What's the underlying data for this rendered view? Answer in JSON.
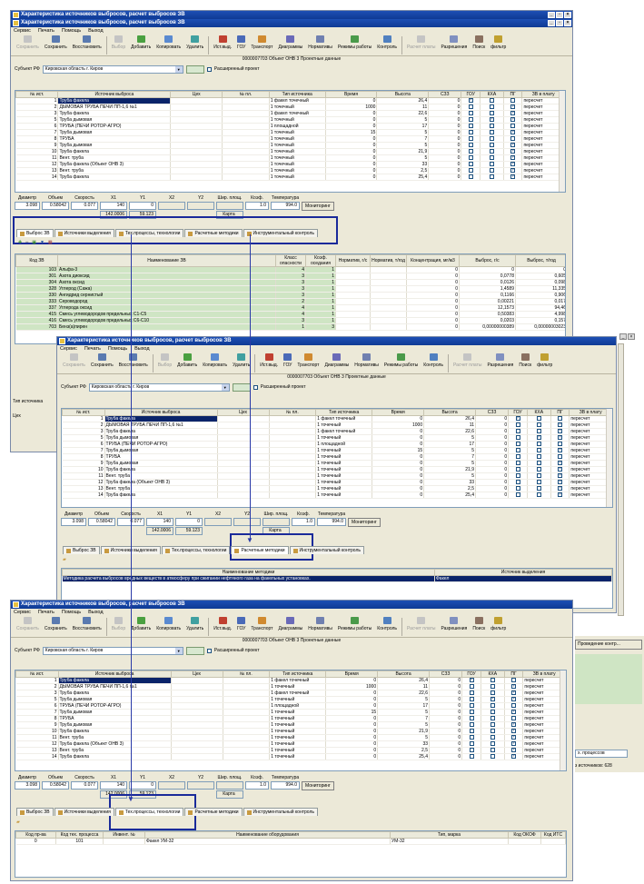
{
  "app_title": "Характеристика источников выбросов, расчет выбросов ЗВ",
  "menu": [
    "Сервис",
    "Печать",
    "Помощь",
    "Выход"
  ],
  "toolbar": [
    {
      "label": "Сохранить",
      "disabled": true,
      "icon": "save-icon"
    },
    {
      "label": "Сохранить",
      "disabled": false,
      "icon": "save-icon"
    },
    {
      "label": "Восстановить",
      "disabled": false,
      "icon": "restore-icon"
    },
    {
      "label": "Выбор",
      "disabled": true,
      "icon": "select-icon"
    },
    {
      "label": "Добавить",
      "disabled": false,
      "icon": "add-icon"
    },
    {
      "label": "Копировать",
      "disabled": false,
      "icon": "copy-icon"
    },
    {
      "label": "Удалить",
      "disabled": false,
      "icon": "delete-icon"
    },
    {
      "label": "Ист.выд.",
      "disabled": false,
      "icon": "source-icon"
    },
    {
      "label": "ГОУ",
      "disabled": false,
      "icon": "gou-icon"
    },
    {
      "label": "Транспорт",
      "disabled": false,
      "icon": "truck-icon"
    },
    {
      "label": "Диаграммы",
      "disabled": false,
      "icon": "chart-icon"
    },
    {
      "label": "Нормативы",
      "disabled": false,
      "icon": "norms-icon"
    },
    {
      "label": "Режимы работы",
      "disabled": false,
      "icon": "modes-icon"
    },
    {
      "label": "Контроль",
      "disabled": false,
      "icon": "control-icon"
    },
    {
      "label": "Расчет платы",
      "disabled": true,
      "icon": "calc-icon"
    },
    {
      "label": "Разрешения",
      "disabled": false,
      "icon": "permit-icon"
    },
    {
      "label": "Поиск",
      "disabled": false,
      "icon": "search-icon"
    },
    {
      "label": "фильтр",
      "disabled": false,
      "icon": "filter-icon"
    }
  ],
  "object_line": "0000007703 Объект ОНВ 3 Проектные данные",
  "subject": {
    "label": "Субъект РФ",
    "value": "Кировская область г. Киров",
    "extended": "Расширенный проект"
  },
  "src_cols": [
    "№ ист.",
    "Источник выброса",
    "Цех",
    "№ пл.",
    "Тип источника",
    "Время",
    "Высота",
    "СЗЗ",
    "ГОУ",
    "КХА",
    "ПГ",
    "ЗВ в плату"
  ],
  "sources": [
    {
      "n": "1",
      "name": "Труба факела",
      "type": "1 факел точечный",
      "time": "0",
      "h": "26,4",
      "szz": "0",
      "gou": true,
      "kha": false,
      "pg": false,
      "pay": "пересчет"
    },
    {
      "n": "2",
      "name": "ДЫМОВАЯ ТРУБА ПЕЧИ ПП-1,6 №1",
      "type": "1 точечный",
      "time": "1000",
      "h": "11",
      "szz": "0",
      "gou": false,
      "kha": false,
      "pg": true,
      "pay": "пересчет"
    },
    {
      "n": "3",
      "name": "Труба факела",
      "type": "1 факел точечный",
      "time": "0",
      "h": "22,6",
      "szz": "0",
      "gou": false,
      "kha": false,
      "pg": true,
      "pay": "пересчет"
    },
    {
      "n": "5",
      "name": "Труба дымовая",
      "type": "1 точечный",
      "time": "0",
      "h": "5",
      "szz": "0",
      "gou": false,
      "kha": true,
      "pg": true,
      "pay": "пересчет"
    },
    {
      "n": "6",
      "name": "ТРУБА (ПЕЧИ РОТОР-АГРО)",
      "type": "1 площадной",
      "time": "0",
      "h": "17",
      "szz": "0",
      "gou": false,
      "kha": false,
      "pg": false,
      "pay": "пересчет"
    },
    {
      "n": "7",
      "name": "Труба дымовая",
      "type": "1 точечный",
      "time": "15",
      "h": "5",
      "szz": "0",
      "gou": false,
      "kha": false,
      "pg": true,
      "pay": "пересчет"
    },
    {
      "n": "8",
      "name": "ТРУБА",
      "type": "1 точечный",
      "time": "0",
      "h": "7",
      "szz": "0",
      "gou": false,
      "kha": false,
      "pg": false,
      "pay": "пересчет"
    },
    {
      "n": "9",
      "name": "Труба дымовая",
      "type": "1 точечный",
      "time": "0",
      "h": "5",
      "szz": "0",
      "gou": false,
      "kha": false,
      "pg": true,
      "pay": "пересчет"
    },
    {
      "n": "10",
      "name": "Труба факела",
      "type": "1 точечный",
      "time": "0",
      "h": "21,9",
      "szz": "0",
      "gou": false,
      "kha": false,
      "pg": true,
      "pay": "пересчет"
    },
    {
      "n": "11",
      "name": "Вент. труба",
      "type": "1 точечный",
      "time": "0",
      "h": "5",
      "szz": "0",
      "gou": false,
      "kha": false,
      "pg": true,
      "pay": "пересчет"
    },
    {
      "n": "12",
      "name": "Труба факела (Объект ОНВ 3)",
      "type": "1 точечный",
      "time": "0",
      "h": "33",
      "szz": "0",
      "gou": false,
      "kha": false,
      "pg": true,
      "pay": "пересчет"
    },
    {
      "n": "13",
      "name": "Вент. труба",
      "type": "1 точечный",
      "time": "0",
      "h": "2,5",
      "szz": "0",
      "gou": false,
      "kha": false,
      "pg": true,
      "pay": "пересчет"
    },
    {
      "n": "14",
      "name": "Труба факела",
      "type": "1 точечный",
      "time": "0",
      "h": "25,4",
      "szz": "0",
      "gou": false,
      "kha": false,
      "pg": true,
      "pay": "пересчет"
    }
  ],
  "params": {
    "labels": [
      "Диаметр",
      "Объем",
      "Скорость",
      "X1",
      "Y1",
      "X2",
      "Y2",
      "Шир. площ.",
      "Коэф.",
      "Температура"
    ],
    "values": [
      "3.098",
      "0.58042",
      "0.077",
      "140",
      "0",
      "",
      "",
      "",
      "1.0",
      "994.0"
    ],
    "sub_values": [
      "142.0006",
      "59.123"
    ],
    "map_btn": "Карта",
    "monitor_btn": "Мониторинг"
  },
  "tabs": [
    "Выброс ЗВ",
    "Источники выделения",
    "Тех.процессы, технологии",
    "Расчетные методики",
    "Инструментальный контроль"
  ],
  "zv_cols": [
    "Код ЗВ",
    "Наименование ЗВ",
    "Класс опасности",
    "Коэф. оседания",
    "Норматив, г/с",
    "Норматив, т/год",
    "Концентрация, мг/м3",
    "Выброс, г/с",
    "Выброс, т/год"
  ],
  "zv_rows": [
    {
      "code": "103",
      "name": "Альфа-3",
      "cls": "4",
      "k": "1",
      "conc": "0",
      "gs": "0",
      "ty": "0"
    },
    {
      "code": "301",
      "name": "Азота диоксид",
      "cls": "3",
      "k": "1",
      "conc": "0",
      "gs": "0,0778",
      "ty": "0,605"
    },
    {
      "code": "304",
      "name": "Азота оксид",
      "cls": "3",
      "k": "1",
      "conc": "0",
      "gs": "0,0126",
      "ty": "0,098"
    },
    {
      "code": "328",
      "name": "Углерод (Сажа)",
      "cls": "3",
      "k": "1",
      "conc": "0",
      "gs": "1,4589",
      "ty": "11,335"
    },
    {
      "code": "330",
      "name": "Ангидрид сернистый",
      "cls": "3",
      "k": "1",
      "conc": "0",
      "gs": "0,1166",
      "ty": "0,906"
    },
    {
      "code": "333",
      "name": "Сероводород",
      "cls": "2",
      "k": "1",
      "conc": "0",
      "gs": "0,00221",
      "ty": "0,017"
    },
    {
      "code": "337",
      "name": "Углерода оксид",
      "cls": "4",
      "k": "1",
      "conc": "0",
      "gs": "12,1573",
      "ty": "94,46"
    },
    {
      "code": "415",
      "name": "Смесь углеводородов предельных С1-С5",
      "cls": "4",
      "k": "1",
      "conc": "0",
      "gs": "0,50383",
      "ty": "4,998"
    },
    {
      "code": "416",
      "name": "Смесь углеводородов предельных С6-С10",
      "cls": "3",
      "k": "1",
      "conc": "0",
      "gs": "0,0203",
      "ty": "0,157"
    },
    {
      "code": "703",
      "name": "Бенз(а)пирен",
      "cls": "1",
      "k": "3",
      "conc": "0",
      "gs": "0,00000000389",
      "ty": "0,00000003023"
    }
  ],
  "left_misc": {
    "src_type": "Тип источника",
    "shop": "Цех"
  },
  "method_cols": [
    "Наименование методики",
    "Источник выделения"
  ],
  "method_row": {
    "name": "Методика расчета выбросов вредных веществ в атмосферу при сжигании нефтяного газа на факельных установках.",
    "src": "Факел"
  },
  "tech_cols": [
    "Код пр-ва",
    "Код тех. процесса",
    "Инвент. №",
    "Наименование оборудования",
    "Тип, марка",
    "Код ОКОФ",
    "Код ИТС"
  ],
  "tech_row": {
    "prod": "0",
    "proc": "101",
    "inv": "",
    "name": "Факел УМ-32",
    "type": "УМ-32",
    "okof": "",
    "its": ""
  },
  "right_misc": {
    "btn": "Проведение контр...",
    "combo": "х. процессов",
    "count": "з источников: 628"
  }
}
